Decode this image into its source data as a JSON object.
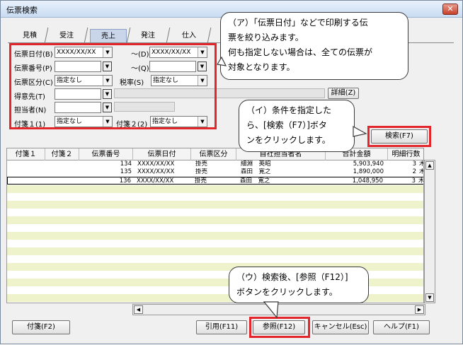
{
  "window": {
    "title": "伝票検索",
    "close_glyph": "✕"
  },
  "tabs": [
    {
      "label": "見積"
    },
    {
      "label": "受注"
    },
    {
      "label": "売上"
    },
    {
      "label": "発注"
    },
    {
      "label": "仕入"
    }
  ],
  "filters": {
    "date_label": "伝票日付(B)",
    "date_from": "XXXX/XX/XX",
    "date_to_label": "～(D)",
    "date_to": "XXXX/XX/XX",
    "number_label": "伝票番号(P)",
    "number_to_label": "～(Q)",
    "division_label": "伝票区分(C)",
    "division_value": "指定なし",
    "tax_label": "税率(S)",
    "tax_value": "指定なし",
    "customer_label": "得意先(T)",
    "staff_label": "担当者(N)",
    "tag1_label": "付箋１(1)",
    "tag1_value": "指定なし",
    "tag2_label": "付箋２(2)",
    "tag2_value": "指定なし",
    "detail_button": "詳細(Z)"
  },
  "search_button": "検索(F7)",
  "callouts": {
    "a_line1": "（ア）「伝票日付」などで印刷する伝",
    "a_line2": "票を絞り込みます。",
    "a_line3": "何も指定しない場合は、全ての伝票が",
    "a_line4": "対象となります。",
    "b_line1": "（イ）条件を指定した",
    "b_line2": "ら、[検索（F7）]ボタ",
    "b_line3": "ンをクリックします。",
    "c_line1": "（ウ）検索後、[参照（F12）]",
    "c_line2": "ボタンをクリックします。"
  },
  "grid": {
    "headers": [
      "付箋１",
      "付箋２",
      "伝票番号",
      "伝票日付",
      "伝票区分",
      "自社担当者名",
      "合計金額",
      "明細行数"
    ],
    "rows": [
      {
        "number": "134",
        "date": "XXXX/XX/XX",
        "division": "掛売",
        "staff": "細淵　英昭",
        "total": "5,903,940",
        "lines": "3",
        "extra": "木"
      },
      {
        "number": "135",
        "date": "XXXX/XX/XX",
        "division": "掛売",
        "staff": "森田　寛之",
        "total": "1,890,000",
        "lines": "2",
        "extra": "木"
      },
      {
        "number": "136",
        "date": "XXXX/XX/XX",
        "division": "掛売",
        "staff": "森田　寛之",
        "total": "1,048,950",
        "lines": "3",
        "extra": "木"
      }
    ]
  },
  "footer": {
    "tag_button": "付箋(F2)",
    "cite_button": "引用(F11)",
    "ref_button": "参照(F12)",
    "cancel_button": "キャンセル(Esc)",
    "help_button": "ヘルプ(F1)"
  },
  "glyphs": {
    "down": "▼",
    "up": "▲",
    "left": "◀",
    "right": "▶"
  },
  "colors": {
    "highlight": "#e3262b",
    "active_tab": "#c9d6ea",
    "row_alt": "#eef3cc"
  }
}
